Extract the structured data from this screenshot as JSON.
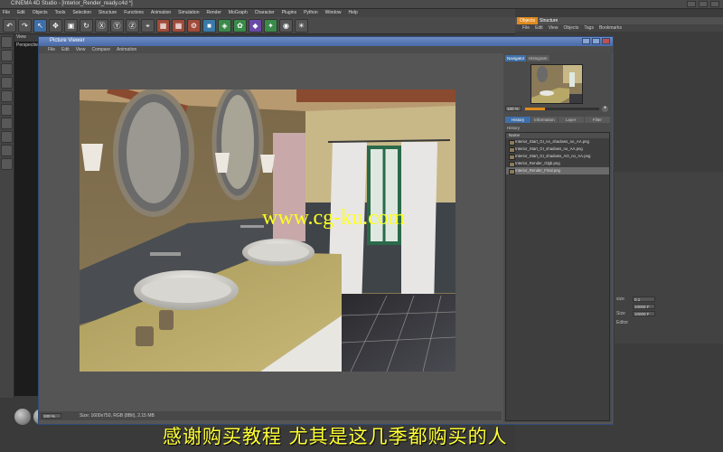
{
  "app": {
    "title": "CINEMA 4D Studio - [Interior_Render_ready.c4d *]"
  },
  "menubar": [
    "File",
    "Edit",
    "Objects",
    "Tools",
    "Selection",
    "Structure",
    "Functions",
    "Animation",
    "Simulation",
    "Render",
    "MoGraph",
    "Character",
    "Plugins",
    "Python",
    "Window",
    "Help"
  ],
  "viewport": {
    "tab": "View",
    "label": "Perspective"
  },
  "right_panel": {
    "tabs": [
      "Objects",
      "Structure"
    ],
    "menu": [
      "File",
      "Edit",
      "View",
      "Objects",
      "Tags",
      "Bookmarks"
    ]
  },
  "attributes": {
    "rows": [
      {
        "label": "size",
        "value": "0.1"
      },
      {
        "label": "",
        "value": "10000 F"
      },
      {
        "label": "Size",
        "value": "10000 F"
      },
      {
        "label": "Editor",
        "value": ""
      }
    ]
  },
  "picture_viewer": {
    "title": "Picture Viewer",
    "menu": [
      "File",
      "Edit",
      "View",
      "Compare",
      "Animation"
    ],
    "zoom": "100 %",
    "status": "Size: 1600x750, RGB (8Bit), 2.15 MB",
    "side_tabs": [
      "Navigator",
      "Histogram"
    ],
    "thumb_zoom": "100 %",
    "thumb_zoom_fraction": 0.27,
    "history_tabs": [
      "History",
      "Information",
      "Layer",
      "Filter"
    ],
    "history_label": "History",
    "list_header": "Name",
    "history_items": [
      "Interior_Start_GI_no_shadows_no_AA.png",
      "Interior_Start_GI_shadows_no_AA.png",
      "Interior_Start_GI_shadows_AO_no_AA.png",
      "Interior_Render_Glgb.png",
      "Interior_Render_Final.png"
    ],
    "selected_index": 4
  },
  "overlay": {
    "watermark": "www.cg-ku.com",
    "subtitle": "感谢购买教程  尤其是这几季都购买的人"
  },
  "colors": {
    "accent": "#3f6fa8",
    "subtitle": "#ffff33",
    "slider": "#e08a1e"
  }
}
